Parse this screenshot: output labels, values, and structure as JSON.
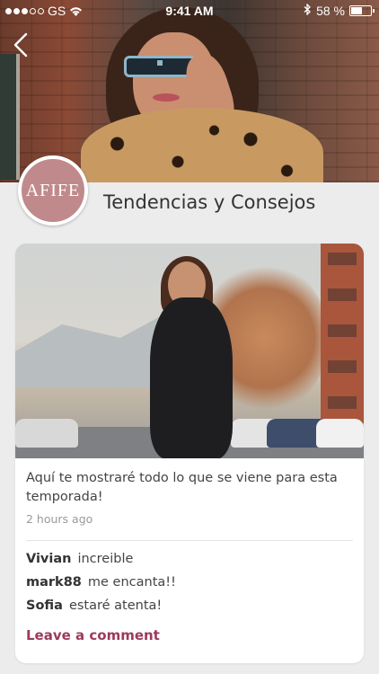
{
  "status_bar": {
    "carrier": "GS",
    "time": "9:41 AM",
    "battery_text": "58 %",
    "battery_level": 0.58,
    "signal_bars_filled": 3,
    "signal_bars_total": 5
  },
  "header": {
    "back_icon": "chevron-left-icon"
  },
  "profile": {
    "avatar_text": "AFIFE",
    "avatar_color": "#c08a8d",
    "title": "Tendencias y Consejos"
  },
  "post": {
    "caption": "Aquí te mostraré todo lo que se viene para esta temporada!",
    "time_ago": "2 hours ago",
    "comments": [
      {
        "user": "Vivian",
        "text": "increible"
      },
      {
        "user": "mark88",
        "text": "me encanta!!"
      },
      {
        "user": "Sofia",
        "text": "estaré atenta!"
      }
    ],
    "leave_comment_label": "Leave a comment",
    "accent_color": "#9b3a5a"
  }
}
